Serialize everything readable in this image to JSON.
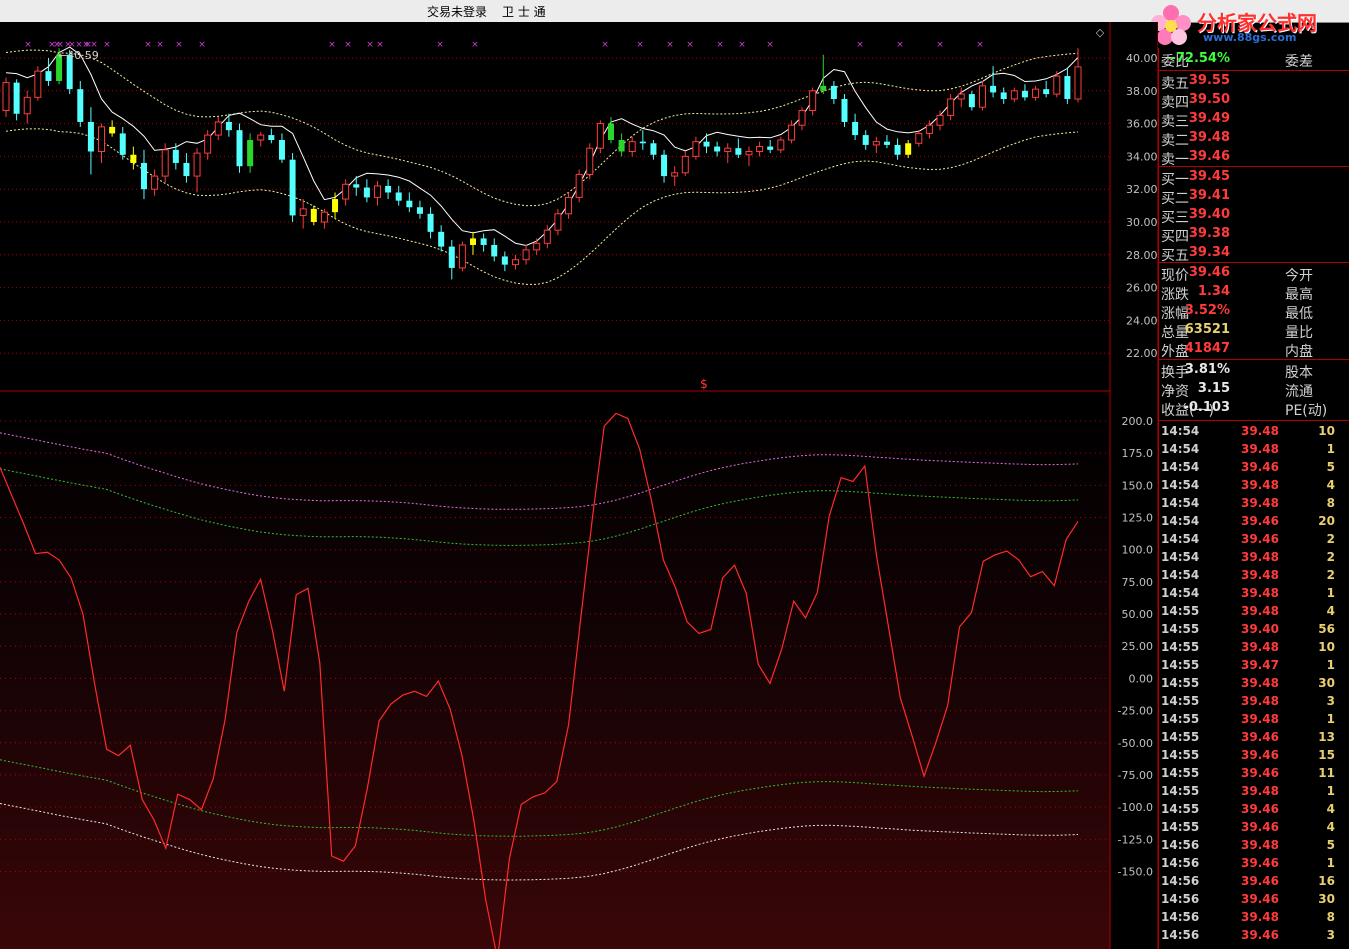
{
  "window": {
    "title": "交易未登录",
    "app": "卫 士 通",
    "watermark_logo": "分析家公式网",
    "watermark_site": "www.88gs.com"
  },
  "price_axis": [
    "40.00",
    "38.00",
    "36.00",
    "34.00",
    "32.00",
    "30.00",
    "28.00",
    "26.00",
    "24.00",
    "22.00"
  ],
  "osc_axis": [
    "200.0",
    "175.0",
    "150.0",
    "125.0",
    "100.0",
    "75.00",
    "50.00",
    "25.00",
    "0.00",
    "-25.00",
    "-50.00",
    "-75.00",
    "-100.0",
    "-125.0",
    "-150.0"
  ],
  "chart_marker": "$",
  "high_label": "40.59",
  "quote": {
    "weibi_label": "委比",
    "weibi_value": "-72.54%",
    "weicha_label": "委差",
    "asks": [
      {
        "label": "卖五",
        "price": "39.55"
      },
      {
        "label": "卖四",
        "price": "39.50"
      },
      {
        "label": "卖三",
        "price": "39.49"
      },
      {
        "label": "卖二",
        "price": "39.48"
      },
      {
        "label": "卖一",
        "price": "39.46"
      }
    ],
    "bids": [
      {
        "label": "买一",
        "price": "39.45"
      },
      {
        "label": "买二",
        "price": "39.41"
      },
      {
        "label": "买三",
        "price": "39.40"
      },
      {
        "label": "买四",
        "price": "39.38"
      },
      {
        "label": "买五",
        "price": "39.34"
      }
    ],
    "stats": [
      {
        "label": "现价",
        "value": "39.46",
        "label2": "今开",
        "cls": "red"
      },
      {
        "label": "涨跌",
        "value": "1.34",
        "label2": "最高",
        "cls": "red"
      },
      {
        "label": "涨幅",
        "value": "3.52%",
        "label2": "最低",
        "cls": "red"
      },
      {
        "label": "总量",
        "value": "63521",
        "label2": "量比",
        "cls": "yel"
      },
      {
        "label": "外盘",
        "value": "41847",
        "label2": "内盘",
        "cls": "red"
      }
    ],
    "fund": [
      {
        "label": "换手",
        "value": "3.81%",
        "label2": "股本"
      },
      {
        "label": "净资",
        "value": "3.15",
        "label2": "流通"
      },
      {
        "label": "收益(一)",
        "value": "-0.103",
        "label2": "PE(动)"
      }
    ]
  },
  "ticks": [
    {
      "t": "14:54",
      "p": "39.48",
      "v": "10"
    },
    {
      "t": "14:54",
      "p": "39.48",
      "v": "1"
    },
    {
      "t": "14:54",
      "p": "39.46",
      "v": "5"
    },
    {
      "t": "14:54",
      "p": "39.48",
      "v": "4"
    },
    {
      "t": "14:54",
      "p": "39.48",
      "v": "8"
    },
    {
      "t": "14:54",
      "p": "39.46",
      "v": "20"
    },
    {
      "t": "14:54",
      "p": "39.46",
      "v": "2"
    },
    {
      "t": "14:54",
      "p": "39.48",
      "v": "2"
    },
    {
      "t": "14:54",
      "p": "39.48",
      "v": "2"
    },
    {
      "t": "14:54",
      "p": "39.48",
      "v": "1"
    },
    {
      "t": "14:55",
      "p": "39.48",
      "v": "4"
    },
    {
      "t": "14:55",
      "p": "39.40",
      "v": "56"
    },
    {
      "t": "14:55",
      "p": "39.48",
      "v": "10"
    },
    {
      "t": "14:55",
      "p": "39.47",
      "v": "1"
    },
    {
      "t": "14:55",
      "p": "39.48",
      "v": "30"
    },
    {
      "t": "14:55",
      "p": "39.48",
      "v": "3"
    },
    {
      "t": "14:55",
      "p": "39.48",
      "v": "1"
    },
    {
      "t": "14:55",
      "p": "39.46",
      "v": "13"
    },
    {
      "t": "14:55",
      "p": "39.46",
      "v": "15"
    },
    {
      "t": "14:55",
      "p": "39.46",
      "v": "11"
    },
    {
      "t": "14:55",
      "p": "39.48",
      "v": "1"
    },
    {
      "t": "14:55",
      "p": "39.46",
      "v": "4"
    },
    {
      "t": "14:55",
      "p": "39.46",
      "v": "4"
    },
    {
      "t": "14:56",
      "p": "39.48",
      "v": "5"
    },
    {
      "t": "14:56",
      "p": "39.46",
      "v": "1"
    },
    {
      "t": "14:56",
      "p": "39.46",
      "v": "16"
    },
    {
      "t": "14:56",
      "p": "39.46",
      "v": "30"
    },
    {
      "t": "14:56",
      "p": "39.48",
      "v": "8"
    },
    {
      "t": "14:56",
      "p": "39.46",
      "v": "3"
    }
  ],
  "colors": {
    "up": "#ff3b3b",
    "down": "#54ffff",
    "grid": "#b00000",
    "accent_yellow": "#ffff00",
    "accent_green": "#2bd62b"
  },
  "chart_data": {
    "type": "candlestick",
    "candles": [
      {
        "o": 36.8,
        "h": 38.8,
        "l": 36.4,
        "c": 38.5
      },
      {
        "o": 38.5,
        "h": 38.7,
        "l": 36.2,
        "c": 36.6
      },
      {
        "o": 36.6,
        "h": 38.0,
        "l": 36.0,
        "c": 37.6
      },
      {
        "o": 37.6,
        "h": 39.5,
        "l": 37.4,
        "c": 39.2
      },
      {
        "o": 39.2,
        "h": 40.0,
        "l": 38.3,
        "c": 38.6
      },
      {
        "o": 38.6,
        "h": 40.6,
        "l": 38.4,
        "c": 40.2
      },
      {
        "o": 40.2,
        "h": 40.5,
        "l": 37.8,
        "c": 38.1
      },
      {
        "o": 38.1,
        "h": 38.6,
        "l": 35.8,
        "c": 36.1
      },
      {
        "o": 36.1,
        "h": 37.0,
        "l": 32.9,
        "c": 34.3
      },
      {
        "o": 34.3,
        "h": 36.0,
        "l": 33.6,
        "c": 35.8
      },
      {
        "o": 35.8,
        "h": 36.2,
        "l": 35.2,
        "c": 35.4
      },
      {
        "o": 35.4,
        "h": 35.8,
        "l": 33.8,
        "c": 34.1
      },
      {
        "o": 34.1,
        "h": 34.6,
        "l": 33.2,
        "c": 33.6
      },
      {
        "o": 33.6,
        "h": 34.4,
        "l": 31.4,
        "c": 32.0
      },
      {
        "o": 32.0,
        "h": 33.2,
        "l": 31.6,
        "c": 32.8
      },
      {
        "o": 32.8,
        "h": 34.8,
        "l": 32.4,
        "c": 34.4
      },
      {
        "o": 34.4,
        "h": 34.8,
        "l": 33.2,
        "c": 33.6
      },
      {
        "o": 33.6,
        "h": 34.2,
        "l": 32.4,
        "c": 32.8
      },
      {
        "o": 32.8,
        "h": 34.5,
        "l": 31.8,
        "c": 34.2
      },
      {
        "o": 34.2,
        "h": 35.6,
        "l": 33.8,
        "c": 35.3
      },
      {
        "o": 35.3,
        "h": 36.4,
        "l": 35.0,
        "c": 36.1
      },
      {
        "o": 36.1,
        "h": 36.6,
        "l": 35.2,
        "c": 35.6
      },
      {
        "o": 35.6,
        "h": 36.0,
        "l": 33.0,
        "c": 33.4
      },
      {
        "o": 33.4,
        "h": 35.4,
        "l": 33.0,
        "c": 35.0
      },
      {
        "o": 35.0,
        "h": 35.5,
        "l": 34.6,
        "c": 35.3
      },
      {
        "o": 35.3,
        "h": 35.7,
        "l": 34.8,
        "c": 35.0
      },
      {
        "o": 35.0,
        "h": 35.4,
        "l": 33.6,
        "c": 33.8
      },
      {
        "o": 33.8,
        "h": 34.2,
        "l": 30.0,
        "c": 30.4
      },
      {
        "o": 30.4,
        "h": 31.4,
        "l": 29.6,
        "c": 30.8
      },
      {
        "o": 30.8,
        "h": 31.0,
        "l": 29.8,
        "c": 30.0
      },
      {
        "o": 30.0,
        "h": 30.8,
        "l": 29.6,
        "c": 30.6
      },
      {
        "o": 30.6,
        "h": 31.8,
        "l": 30.2,
        "c": 31.4
      },
      {
        "o": 31.4,
        "h": 32.6,
        "l": 31.0,
        "c": 32.3
      },
      {
        "o": 32.3,
        "h": 32.8,
        "l": 31.6,
        "c": 32.1
      },
      {
        "o": 32.1,
        "h": 32.6,
        "l": 31.2,
        "c": 31.5
      },
      {
        "o": 31.5,
        "h": 32.5,
        "l": 31.0,
        "c": 32.2
      },
      {
        "o": 32.2,
        "h": 32.6,
        "l": 31.4,
        "c": 31.8
      },
      {
        "o": 31.8,
        "h": 32.2,
        "l": 31.0,
        "c": 31.3
      },
      {
        "o": 31.3,
        "h": 31.8,
        "l": 30.6,
        "c": 30.9
      },
      {
        "o": 30.9,
        "h": 31.3,
        "l": 30.2,
        "c": 30.5
      },
      {
        "o": 30.5,
        "h": 30.9,
        "l": 29.0,
        "c": 29.4
      },
      {
        "o": 29.4,
        "h": 29.8,
        "l": 28.2,
        "c": 28.5
      },
      {
        "o": 28.5,
        "h": 28.9,
        "l": 26.5,
        "c": 27.2
      },
      {
        "o": 27.2,
        "h": 28.8,
        "l": 27.0,
        "c": 28.6
      },
      {
        "o": 28.6,
        "h": 29.4,
        "l": 28.0,
        "c": 29.0
      },
      {
        "o": 29.0,
        "h": 29.3,
        "l": 28.2,
        "c": 28.6
      },
      {
        "o": 28.6,
        "h": 29.0,
        "l": 27.6,
        "c": 27.9
      },
      {
        "o": 27.9,
        "h": 28.2,
        "l": 27.0,
        "c": 27.4
      },
      {
        "o": 27.4,
        "h": 28.0,
        "l": 27.1,
        "c": 27.7
      },
      {
        "o": 27.7,
        "h": 28.6,
        "l": 27.4,
        "c": 28.3
      },
      {
        "o": 28.3,
        "h": 29.0,
        "l": 28.0,
        "c": 28.7
      },
      {
        "o": 28.7,
        "h": 29.8,
        "l": 28.4,
        "c": 29.5
      },
      {
        "o": 29.5,
        "h": 30.8,
        "l": 29.2,
        "c": 30.5
      },
      {
        "o": 30.5,
        "h": 31.8,
        "l": 30.2,
        "c": 31.5
      },
      {
        "o": 31.5,
        "h": 33.2,
        "l": 31.2,
        "c": 32.9
      },
      {
        "o": 32.9,
        "h": 34.8,
        "l": 32.6,
        "c": 34.5
      },
      {
        "o": 34.5,
        "h": 36.2,
        "l": 34.2,
        "c": 36.0
      },
      {
        "o": 36.0,
        "h": 36.4,
        "l": 34.8,
        "c": 35.0
      },
      {
        "o": 35.0,
        "h": 35.4,
        "l": 34.0,
        "c": 34.3
      },
      {
        "o": 34.3,
        "h": 35.2,
        "l": 34.0,
        "c": 34.9
      },
      {
        "o": 34.9,
        "h": 35.6,
        "l": 34.4,
        "c": 34.8
      },
      {
        "o": 34.8,
        "h": 35.0,
        "l": 33.8,
        "c": 34.1
      },
      {
        "o": 34.1,
        "h": 34.4,
        "l": 32.4,
        "c": 32.8
      },
      {
        "o": 32.8,
        "h": 33.4,
        "l": 32.2,
        "c": 33.0
      },
      {
        "o": 33.0,
        "h": 34.3,
        "l": 32.8,
        "c": 34.0
      },
      {
        "o": 34.0,
        "h": 35.2,
        "l": 33.8,
        "c": 34.9
      },
      {
        "o": 34.9,
        "h": 35.4,
        "l": 34.2,
        "c": 34.6
      },
      {
        "o": 34.6,
        "h": 34.9,
        "l": 34.0,
        "c": 34.3
      },
      {
        "o": 34.3,
        "h": 34.8,
        "l": 33.6,
        "c": 34.5
      },
      {
        "o": 34.5,
        "h": 35.1,
        "l": 33.9,
        "c": 34.1
      },
      {
        "o": 34.1,
        "h": 34.6,
        "l": 33.4,
        "c": 34.3
      },
      {
        "o": 34.3,
        "h": 34.9,
        "l": 34.0,
        "c": 34.6
      },
      {
        "o": 34.6,
        "h": 35.0,
        "l": 34.2,
        "c": 34.4
      },
      {
        "o": 34.4,
        "h": 35.2,
        "l": 34.2,
        "c": 35.0
      },
      {
        "o": 35.0,
        "h": 36.2,
        "l": 34.8,
        "c": 35.9
      },
      {
        "o": 35.9,
        "h": 37.0,
        "l": 35.6,
        "c": 36.8
      },
      {
        "o": 36.8,
        "h": 38.2,
        "l": 36.5,
        "c": 38.0
      },
      {
        "o": 38.0,
        "h": 40.2,
        "l": 37.8,
        "c": 38.3
      },
      {
        "o": 38.3,
        "h": 38.6,
        "l": 37.2,
        "c": 37.5
      },
      {
        "o": 37.5,
        "h": 37.8,
        "l": 35.8,
        "c": 36.1
      },
      {
        "o": 36.1,
        "h": 36.6,
        "l": 35.0,
        "c": 35.3
      },
      {
        "o": 35.3,
        "h": 35.6,
        "l": 34.4,
        "c": 34.7
      },
      {
        "o": 34.7,
        "h": 35.2,
        "l": 34.2,
        "c": 34.9
      },
      {
        "o": 34.9,
        "h": 35.3,
        "l": 34.5,
        "c": 34.7
      },
      {
        "o": 34.7,
        "h": 35.1,
        "l": 33.8,
        "c": 34.1
      },
      {
        "o": 34.1,
        "h": 35.0,
        "l": 33.9,
        "c": 34.8
      },
      {
        "o": 34.8,
        "h": 35.6,
        "l": 34.6,
        "c": 35.4
      },
      {
        "o": 35.4,
        "h": 36.2,
        "l": 35.1,
        "c": 35.9
      },
      {
        "o": 35.9,
        "h": 36.8,
        "l": 35.6,
        "c": 36.5
      },
      {
        "o": 36.5,
        "h": 37.8,
        "l": 36.2,
        "c": 37.5
      },
      {
        "o": 37.5,
        "h": 38.2,
        "l": 37.0,
        "c": 37.8
      },
      {
        "o": 37.8,
        "h": 38.0,
        "l": 36.8,
        "c": 37.0
      },
      {
        "o": 37.0,
        "h": 38.6,
        "l": 36.8,
        "c": 38.3
      },
      {
        "o": 38.3,
        "h": 39.5,
        "l": 37.6,
        "c": 37.9
      },
      {
        "o": 37.9,
        "h": 38.2,
        "l": 37.2,
        "c": 37.5
      },
      {
        "o": 37.5,
        "h": 38.2,
        "l": 37.3,
        "c": 38.0
      },
      {
        "o": 38.0,
        "h": 38.4,
        "l": 37.4,
        "c": 37.6
      },
      {
        "o": 37.6,
        "h": 38.3,
        "l": 37.4,
        "c": 38.1
      },
      {
        "o": 38.1,
        "h": 38.6,
        "l": 37.6,
        "c": 37.8
      },
      {
        "o": 37.8,
        "h": 39.2,
        "l": 37.6,
        "c": 38.9
      },
      {
        "o": 38.9,
        "h": 39.4,
        "l": 37.2,
        "c": 37.5
      },
      {
        "o": 37.5,
        "h": 40.6,
        "l": 37.3,
        "c": 39.46
      }
    ],
    "oscillator": [
      164,
      142,
      120,
      97,
      98,
      92,
      78,
      50,
      -5,
      -55,
      -60,
      -52,
      -94,
      -110,
      -132,
      -90,
      -94,
      -102,
      -78,
      -32,
      36,
      60,
      77,
      37,
      -10,
      65,
      70,
      12,
      -138,
      -142,
      -130,
      -86,
      -33,
      -20,
      -13,
      -10,
      -14,
      -2,
      -24,
      -60,
      -110,
      -172,
      -218,
      -140,
      -98,
      -92,
      -89,
      -80,
      -36,
      45,
      124,
      196,
      206,
      202,
      178,
      138,
      92,
      71,
      44,
      35,
      38,
      78,
      88,
      66,
      11,
      -4,
      23,
      60,
      47,
      67,
      126,
      156,
      153,
      165,
      95,
      40,
      -15,
      -45,
      -76,
      -50,
      -21,
      40,
      51,
      91,
      96,
      99,
      92,
      79,
      83,
      72,
      108,
      122
    ]
  }
}
